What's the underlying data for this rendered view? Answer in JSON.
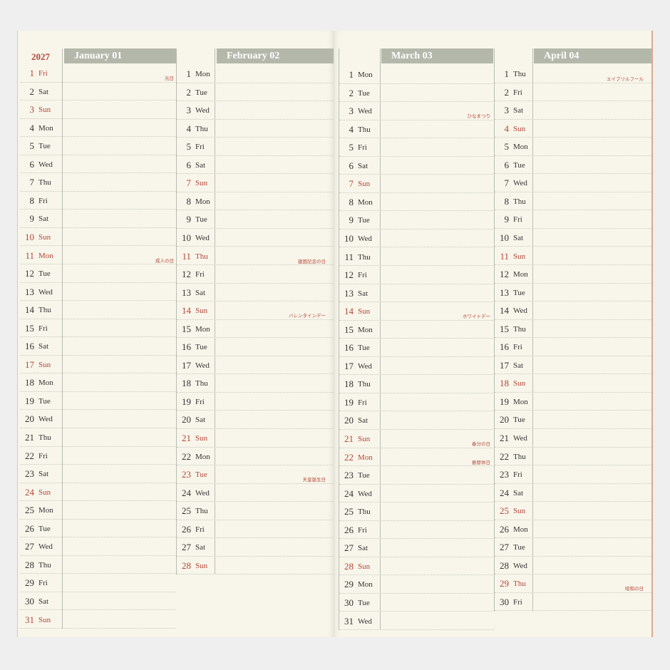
{
  "year": "2027",
  "colors": {
    "accent_red": "#b5453b",
    "header_gray": "#b4b8ab",
    "paper": "#f8f6ea"
  },
  "months": [
    {
      "title": "January 01",
      "days": [
        {
          "n": "1",
          "d": "Fri",
          "red": true,
          "holiday": "元日"
        },
        {
          "n": "2",
          "d": "Sat"
        },
        {
          "n": "3",
          "d": "Sun",
          "red": true
        },
        {
          "n": "4",
          "d": "Mon"
        },
        {
          "n": "5",
          "d": "Tue"
        },
        {
          "n": "6",
          "d": "Wed"
        },
        {
          "n": "7",
          "d": "Thu"
        },
        {
          "n": "8",
          "d": "Fri"
        },
        {
          "n": "9",
          "d": "Sat"
        },
        {
          "n": "10",
          "d": "Sun",
          "red": true
        },
        {
          "n": "11",
          "d": "Mon",
          "red": true,
          "holiday": "成人の日"
        },
        {
          "n": "12",
          "d": "Tue"
        },
        {
          "n": "13",
          "d": "Wed"
        },
        {
          "n": "14",
          "d": "Thu"
        },
        {
          "n": "15",
          "d": "Fri"
        },
        {
          "n": "16",
          "d": "Sat"
        },
        {
          "n": "17",
          "d": "Sun",
          "red": true
        },
        {
          "n": "18",
          "d": "Mon"
        },
        {
          "n": "19",
          "d": "Tue"
        },
        {
          "n": "20",
          "d": "Wed"
        },
        {
          "n": "21",
          "d": "Thu"
        },
        {
          "n": "22",
          "d": "Fri"
        },
        {
          "n": "23",
          "d": "Sat"
        },
        {
          "n": "24",
          "d": "Sun",
          "red": true
        },
        {
          "n": "25",
          "d": "Mon"
        },
        {
          "n": "26",
          "d": "Tue"
        },
        {
          "n": "27",
          "d": "Wed"
        },
        {
          "n": "28",
          "d": "Thu"
        },
        {
          "n": "29",
          "d": "Fri"
        },
        {
          "n": "30",
          "d": "Sat"
        },
        {
          "n": "31",
          "d": "Sun",
          "red": true
        }
      ]
    },
    {
      "title": "February 02",
      "days": [
        {
          "n": "1",
          "d": "Mon"
        },
        {
          "n": "2",
          "d": "Tue"
        },
        {
          "n": "3",
          "d": "Wed"
        },
        {
          "n": "4",
          "d": "Thu"
        },
        {
          "n": "5",
          "d": "Fri"
        },
        {
          "n": "6",
          "d": "Sat"
        },
        {
          "n": "7",
          "d": "Sun",
          "red": true
        },
        {
          "n": "8",
          "d": "Mon"
        },
        {
          "n": "9",
          "d": "Tue"
        },
        {
          "n": "10",
          "d": "Wed"
        },
        {
          "n": "11",
          "d": "Thu",
          "red": true,
          "holiday": "建国記念の日"
        },
        {
          "n": "12",
          "d": "Fri"
        },
        {
          "n": "13",
          "d": "Sat"
        },
        {
          "n": "14",
          "d": "Sun",
          "red": true,
          "holiday": "バレンタインデー"
        },
        {
          "n": "15",
          "d": "Mon"
        },
        {
          "n": "16",
          "d": "Tue"
        },
        {
          "n": "17",
          "d": "Wed"
        },
        {
          "n": "18",
          "d": "Thu"
        },
        {
          "n": "19",
          "d": "Fri"
        },
        {
          "n": "20",
          "d": "Sat"
        },
        {
          "n": "21",
          "d": "Sun",
          "red": true
        },
        {
          "n": "22",
          "d": "Mon"
        },
        {
          "n": "23",
          "d": "Tue",
          "red": true,
          "holiday": "天皇誕生日"
        },
        {
          "n": "24",
          "d": "Wed"
        },
        {
          "n": "25",
          "d": "Thu"
        },
        {
          "n": "26",
          "d": "Fri"
        },
        {
          "n": "27",
          "d": "Sat"
        },
        {
          "n": "28",
          "d": "Sun",
          "red": true
        }
      ]
    },
    {
      "title": "March 03",
      "days": [
        {
          "n": "1",
          "d": "Mon"
        },
        {
          "n": "2",
          "d": "Tue"
        },
        {
          "n": "3",
          "d": "Wed",
          "holiday": "ひなまつり"
        },
        {
          "n": "4",
          "d": "Thu"
        },
        {
          "n": "5",
          "d": "Fri"
        },
        {
          "n": "6",
          "d": "Sat"
        },
        {
          "n": "7",
          "d": "Sun",
          "red": true
        },
        {
          "n": "8",
          "d": "Mon"
        },
        {
          "n": "9",
          "d": "Tue"
        },
        {
          "n": "10",
          "d": "Wed"
        },
        {
          "n": "11",
          "d": "Thu"
        },
        {
          "n": "12",
          "d": "Fri"
        },
        {
          "n": "13",
          "d": "Sat"
        },
        {
          "n": "14",
          "d": "Sun",
          "red": true,
          "holiday": "ホワイトデー"
        },
        {
          "n": "15",
          "d": "Mon"
        },
        {
          "n": "16",
          "d": "Tue"
        },
        {
          "n": "17",
          "d": "Wed"
        },
        {
          "n": "18",
          "d": "Thu"
        },
        {
          "n": "19",
          "d": "Fri"
        },
        {
          "n": "20",
          "d": "Sat"
        },
        {
          "n": "21",
          "d": "Sun",
          "red": true,
          "holiday": "春分の日"
        },
        {
          "n": "22",
          "d": "Mon",
          "red": true,
          "holiday": "振替休日"
        },
        {
          "n": "23",
          "d": "Tue"
        },
        {
          "n": "24",
          "d": "Wed"
        },
        {
          "n": "25",
          "d": "Thu"
        },
        {
          "n": "26",
          "d": "Fri"
        },
        {
          "n": "27",
          "d": "Sat"
        },
        {
          "n": "28",
          "d": "Sun",
          "red": true
        },
        {
          "n": "29",
          "d": "Mon"
        },
        {
          "n": "30",
          "d": "Tue"
        },
        {
          "n": "31",
          "d": "Wed"
        }
      ]
    },
    {
      "title": "April 04",
      "days": [
        {
          "n": "1",
          "d": "Thu",
          "holiday": "エイプリルフール"
        },
        {
          "n": "2",
          "d": "Fri"
        },
        {
          "n": "3",
          "d": "Sat"
        },
        {
          "n": "4",
          "d": "Sun",
          "red": true
        },
        {
          "n": "5",
          "d": "Mon"
        },
        {
          "n": "6",
          "d": "Tue"
        },
        {
          "n": "7",
          "d": "Wed"
        },
        {
          "n": "8",
          "d": "Thu"
        },
        {
          "n": "9",
          "d": "Fri"
        },
        {
          "n": "10",
          "d": "Sat"
        },
        {
          "n": "11",
          "d": "Sun",
          "red": true
        },
        {
          "n": "12",
          "d": "Mon"
        },
        {
          "n": "13",
          "d": "Tue"
        },
        {
          "n": "14",
          "d": "Wed"
        },
        {
          "n": "15",
          "d": "Thu"
        },
        {
          "n": "16",
          "d": "Fri"
        },
        {
          "n": "17",
          "d": "Sat"
        },
        {
          "n": "18",
          "d": "Sun",
          "red": true
        },
        {
          "n": "19",
          "d": "Mon"
        },
        {
          "n": "20",
          "d": "Tue"
        },
        {
          "n": "21",
          "d": "Wed"
        },
        {
          "n": "22",
          "d": "Thu"
        },
        {
          "n": "23",
          "d": "Fri"
        },
        {
          "n": "24",
          "d": "Sat"
        },
        {
          "n": "25",
          "d": "Sun",
          "red": true
        },
        {
          "n": "26",
          "d": "Mon"
        },
        {
          "n": "27",
          "d": "Tue"
        },
        {
          "n": "28",
          "d": "Wed"
        },
        {
          "n": "29",
          "d": "Thu",
          "red": true,
          "holiday": "昭和の日"
        },
        {
          "n": "30",
          "d": "Fri"
        }
      ]
    }
  ]
}
